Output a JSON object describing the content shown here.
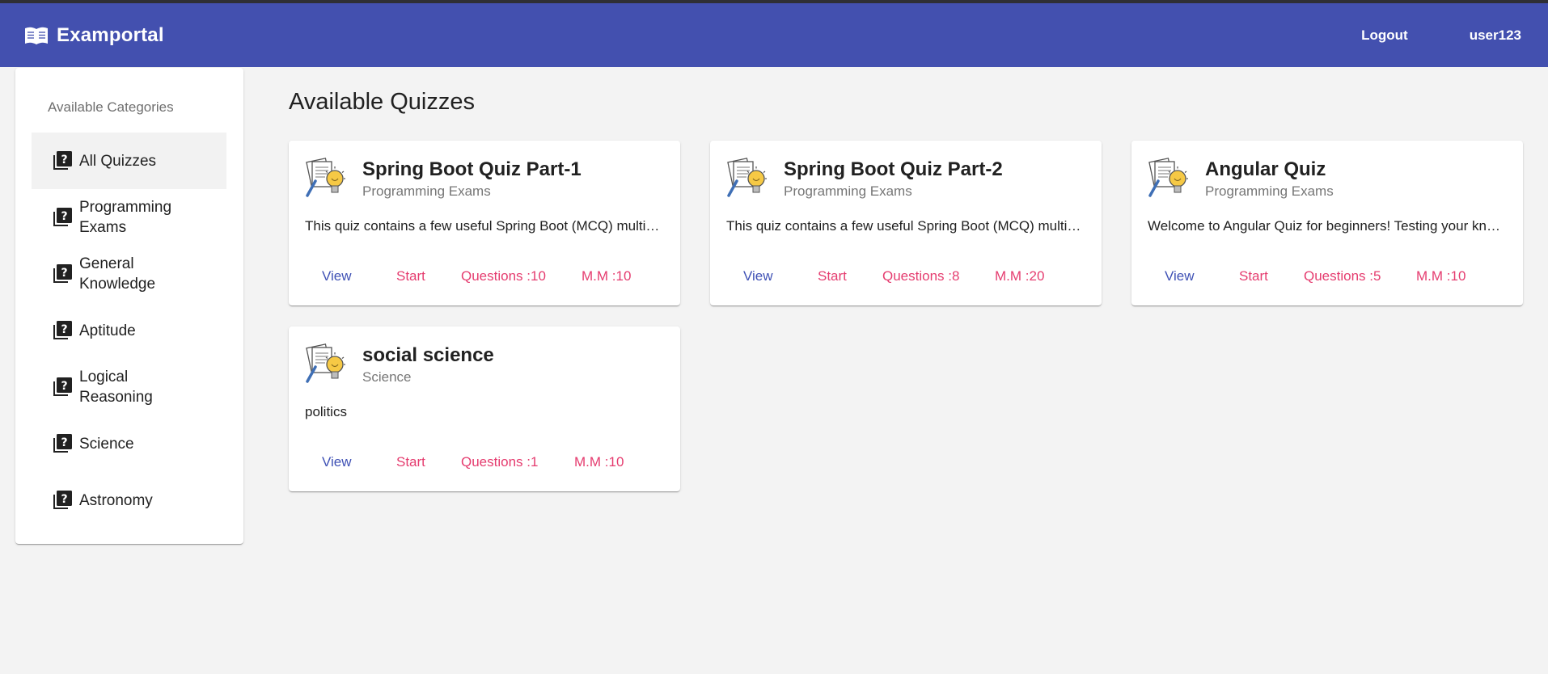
{
  "colors": {
    "navbar": "#4350af",
    "primary": "#3f51b5",
    "accent": "#e53c6f",
    "background": "#f3f3f3"
  },
  "navbar": {
    "brand_icon": "book-open-icon",
    "brand": "Examportal",
    "logout": "Logout",
    "username": "user123"
  },
  "sidebar": {
    "heading": "Available Categories",
    "item_icon": "quiz-icon",
    "items": [
      {
        "label": "All Quizzes",
        "active": true
      },
      {
        "label": "Programming Exams",
        "active": false
      },
      {
        "label": "General Knowledge",
        "active": false
      },
      {
        "label": "Aptitude",
        "active": false
      },
      {
        "label": "Logical Reasoning",
        "active": false
      },
      {
        "label": "Science",
        "active": false
      },
      {
        "label": "Astronomy",
        "active": false
      }
    ]
  },
  "main": {
    "title": "Available Quizzes",
    "card_icon": "quiz-document-bulb-icon",
    "quizzes": [
      {
        "title": "Spring Boot Quiz Part-1",
        "category": "Programming Exams",
        "description": "This quiz contains a few useful Spring Boot (MCQ) multiple choice questions.",
        "view": "View",
        "start": "Start",
        "questions": "Questions :10",
        "marks": "M.M :10"
      },
      {
        "title": "Spring Boot Quiz Part-2",
        "category": "Programming Exams",
        "description": "This quiz contains a few useful Spring Boot (MCQ) multiple choice questions.",
        "view": "View",
        "start": "Start",
        "questions": "Questions :8",
        "marks": "M.M :20"
      },
      {
        "title": "Angular Quiz",
        "category": "Programming Exams",
        "description": "Welcome to Angular Quiz for beginners! Testing your knowledge of Angular basics.",
        "view": "View",
        "start": "Start",
        "questions": "Questions :5",
        "marks": "M.M :10"
      },
      {
        "title": "social science",
        "category": "Science",
        "description": "politics",
        "view": "View",
        "start": "Start",
        "questions": "Questions :1",
        "marks": "M.M :10"
      }
    ]
  }
}
